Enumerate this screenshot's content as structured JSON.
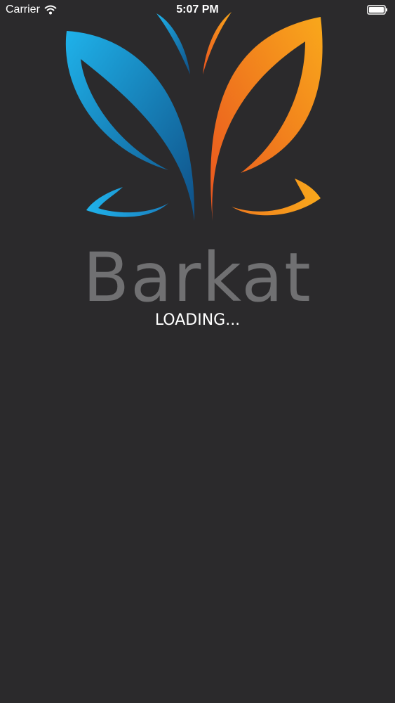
{
  "status_bar": {
    "carrier": "Carrier",
    "time": "5:07 PM"
  },
  "splash": {
    "brand_name": "Barkat",
    "loading_text": "LOADING..."
  },
  "icons": {
    "wifi": "wifi-icon",
    "battery": "battery-icon",
    "logo": "butterfly-logo"
  },
  "colors": {
    "background": "#2b2a2c",
    "brand_text": "#707072",
    "blue_wing": "#1ba8e0",
    "orange_wing": "#f7a11a"
  }
}
